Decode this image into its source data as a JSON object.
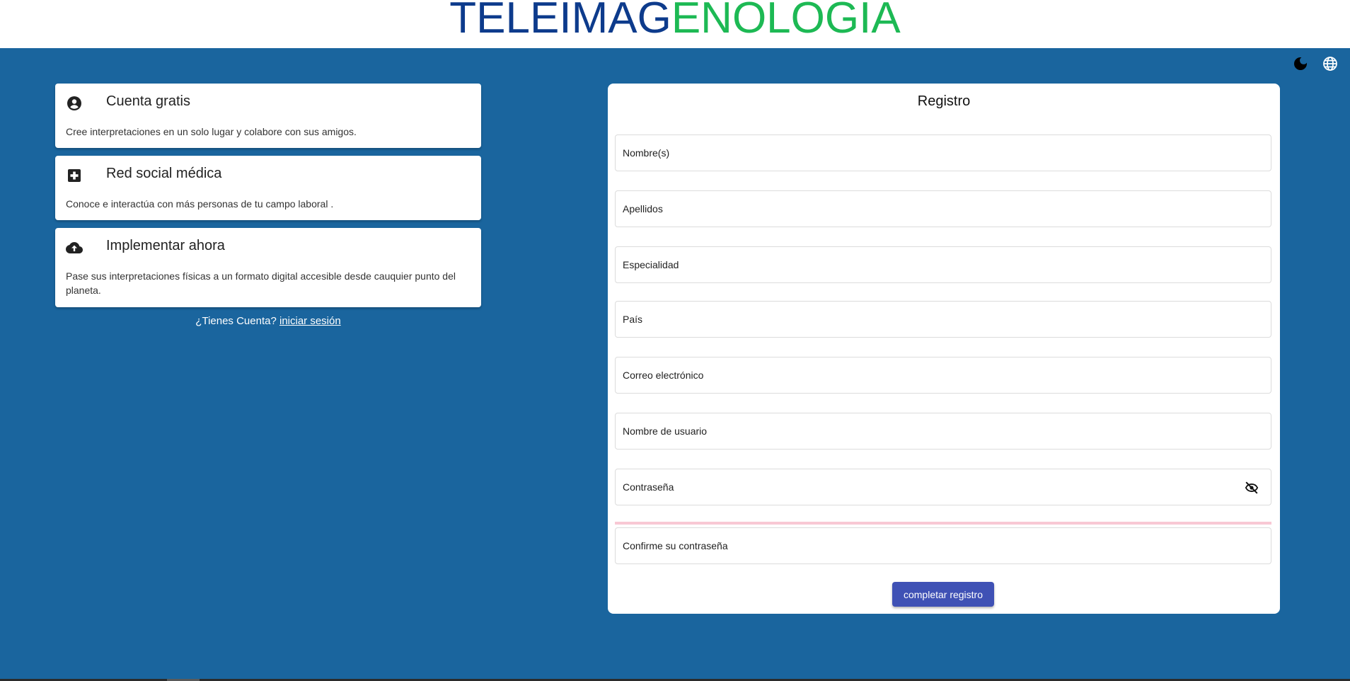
{
  "header": {
    "logo_part1": "TELEIMAG",
    "logo_part2": "ENOLOGIA",
    "color_part1": "#0d3b8c",
    "color_part2": "#1db954"
  },
  "top_icons": {
    "theme_icon": "moon-icon",
    "language_icon": "globe-icon"
  },
  "features": [
    {
      "icon": "account-circle-icon",
      "title": "Cuenta gratis",
      "text": "Cree interpretaciones en un solo lugar y colabore con sus amigos."
    },
    {
      "icon": "medical-plus-icon",
      "title": "Red social médica",
      "text": "Conoce e interactúa con más personas de tu campo laboral ."
    },
    {
      "icon": "cloud-upload-icon",
      "title": "Implementar ahora",
      "text": "Pase sus interpretaciones físicas a un formato digital accesible desde cauquier punto del planeta."
    }
  ],
  "login": {
    "prompt": "¿Tienes Cuenta?",
    "link": "iniciar sesión"
  },
  "form": {
    "title": "Registro",
    "fields": [
      {
        "label": "Nombre(s)"
      },
      {
        "label": "Apellidos"
      },
      {
        "label": "Especialidad"
      },
      {
        "label": "País"
      },
      {
        "label": "Correo electrónico"
      },
      {
        "label": "Nombre de usuario"
      },
      {
        "label": "Contraseña",
        "icon": "eye-off-icon"
      },
      {
        "label": "Confirme su contraseña"
      }
    ],
    "submit_label": "completar registro"
  },
  "colors": {
    "background": "#1a659e",
    "button": "#3f51b5",
    "error_line": "#f8c8d4"
  }
}
